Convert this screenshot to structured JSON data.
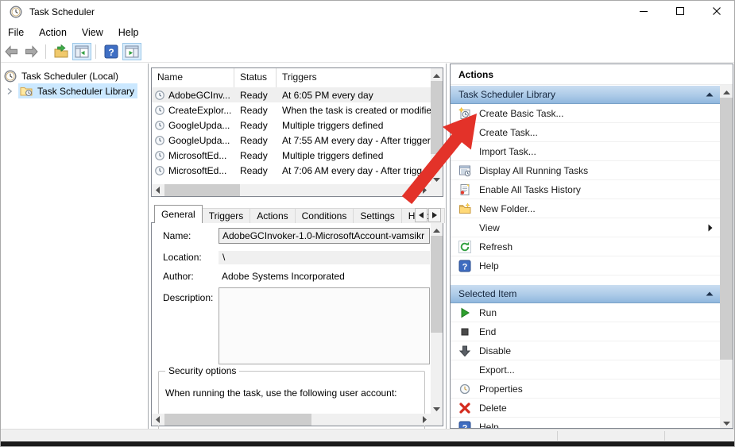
{
  "window": {
    "title": "Task Scheduler"
  },
  "menu": {
    "items": [
      "File",
      "Action",
      "View",
      "Help"
    ]
  },
  "toolbar": {
    "buttons": [
      {
        "icon": "back-icon"
      },
      {
        "icon": "forward-icon"
      },
      {
        "separator": true
      },
      {
        "icon": "export-folder-icon"
      },
      {
        "icon": "console-tree-toggle-icon",
        "highlighted": true
      },
      {
        "separator": true
      },
      {
        "icon": "help-toolbar-icon"
      },
      {
        "icon": "action-pane-toggle-icon",
        "highlighted": true
      }
    ]
  },
  "tree": {
    "root": {
      "label": "Task Scheduler (Local)",
      "icon": "task-scheduler-icon"
    },
    "library": {
      "label": "Task Scheduler Library",
      "icon": "folder-clock-icon"
    }
  },
  "task_list": {
    "columns": [
      "Name",
      "Status",
      "Triggers"
    ],
    "rows": [
      {
        "icon": "task-clock-icon",
        "name": "AdobeGCInv...",
        "status": "Ready",
        "triggers": "At 6:05 PM every day",
        "selected": true
      },
      {
        "icon": "task-clock-icon",
        "name": "CreateExplor...",
        "status": "Ready",
        "triggers": "When the task is created or modifie"
      },
      {
        "icon": "task-clock-icon",
        "name": "GoogleUpda...",
        "status": "Ready",
        "triggers": "Multiple triggers defined"
      },
      {
        "icon": "task-clock-icon",
        "name": "GoogleUpda...",
        "status": "Ready",
        "triggers": "At 7:55 AM every day - After trigger"
      },
      {
        "icon": "task-clock-icon",
        "name": "MicrosoftEd...",
        "status": "Ready",
        "triggers": "Multiple triggers defined"
      },
      {
        "icon": "task-clock-icon",
        "name": "MicrosoftEd...",
        "status": "Ready",
        "triggers": "At 7:06 AM every day - After trigg"
      }
    ]
  },
  "details": {
    "tabs": [
      {
        "label": "General",
        "active": true
      },
      {
        "label": "Triggers"
      },
      {
        "label": "Actions"
      },
      {
        "label": "Conditions"
      },
      {
        "label": "Settings"
      },
      {
        "label": "History"
      }
    ],
    "fields": {
      "name_label": "Name:",
      "name_value": "AdobeGCInvoker-1.0-MicrosoftAccount-vamsikr",
      "location_label": "Location:",
      "location_value": "\\",
      "author_label": "Author:",
      "author_value": "Adobe Systems Incorporated",
      "description_label": "Description:",
      "description_value": ""
    },
    "security": {
      "group_title": "Security options",
      "line1": "When running the task, use the following user account:"
    }
  },
  "actions": {
    "title": "Actions",
    "sections": [
      {
        "header": "Task Scheduler Library",
        "items": [
          {
            "icon": "create-basic-task-icon",
            "label": "Create Basic Task..."
          },
          {
            "label": "Create Task..."
          },
          {
            "label": "Import Task..."
          },
          {
            "icon": "running-tasks-icon",
            "label": "Display All Running Tasks"
          },
          {
            "icon": "history-icon",
            "label": "Enable All Tasks History"
          },
          {
            "icon": "new-folder-icon",
            "label": "New Folder..."
          },
          {
            "label": "View",
            "submenu": true
          },
          {
            "icon": "refresh-icon",
            "label": "Refresh"
          },
          {
            "icon": "help-icon",
            "label": "Help"
          }
        ]
      },
      {
        "header": "Selected Item",
        "items": [
          {
            "icon": "run-icon",
            "label": "Run"
          },
          {
            "icon": "end-icon",
            "label": "End"
          },
          {
            "icon": "disable-icon",
            "label": "Disable"
          },
          {
            "label": "Export..."
          },
          {
            "icon": "properties-icon",
            "label": "Properties"
          },
          {
            "icon": "delete-icon",
            "label": "Delete"
          },
          {
            "icon": "help-icon",
            "label": "Help",
            "clipped": true
          }
        ]
      }
    ]
  },
  "annotation": {
    "arrow_color": "#e33229"
  }
}
